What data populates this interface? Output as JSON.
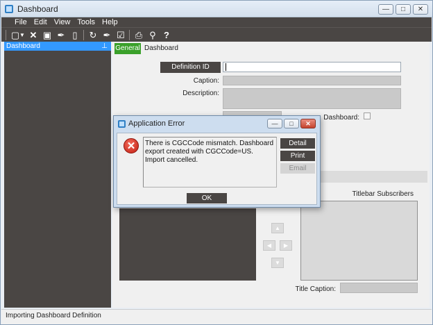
{
  "window": {
    "title": "Dashboard"
  },
  "menu": [
    "File",
    "Edit",
    "View",
    "Tools",
    "Help"
  ],
  "toolbar_icons": [
    "new-icon",
    "dropdown-arrow-icon",
    "delete-icon",
    "save-icon",
    "clear-icon",
    "note-icon",
    "refresh-icon",
    "brush-icon",
    "edit-form-icon",
    "print-icon",
    "print-preview-icon",
    "help-icon"
  ],
  "sidebar": {
    "header": "Dashboard",
    "pin_glyph": "⊥"
  },
  "tabs": {
    "general": "General",
    "dashboard": "Dashboard"
  },
  "form": {
    "definition_id_label": "Definition ID",
    "definition_id_value": "",
    "caption_label": "Caption:",
    "description_label": "Description:",
    "dashboard_label": "Dashboard:",
    "titlebar_subscribers_label": "Titlebar Subscribers",
    "title_caption_label": "Title Caption:"
  },
  "status": "Importing Dashboard Definition",
  "dialog": {
    "title": "Application Error",
    "message": "There is CGCCode mismatch.  Dashboard export created with CGCCode=US.  Import cancelled.",
    "buttons": {
      "detail": "Detail",
      "print": "Print",
      "email": "Email",
      "ok": "OK"
    }
  },
  "colors": {
    "dark": "#4a4644",
    "accent_blue": "#3399ff",
    "tab_green": "#3aa02a",
    "error_red": "#c21d12"
  }
}
